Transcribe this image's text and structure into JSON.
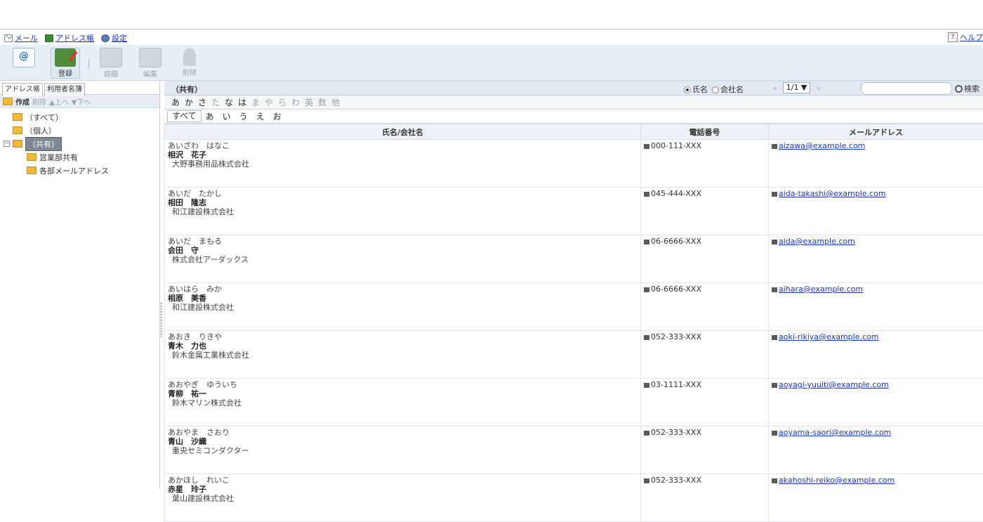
{
  "topbar": {
    "menu": [
      {
        "label": "メール",
        "icon": "mail-icon"
      },
      {
        "label": "アドレス帳",
        "icon": "address-book-icon"
      },
      {
        "label": "設定",
        "icon": "gear-icon"
      }
    ],
    "help_label": "ヘルプ"
  },
  "toolbar": {
    "mail": "",
    "register": "登録",
    "detail": "詳細",
    "edit": "編集",
    "delete": "削除"
  },
  "left": {
    "tabs": [
      "アドレス帳",
      "利用者名簿"
    ],
    "actions": {
      "create": "作成",
      "delete": "削除",
      "up": "▲上へ",
      "down": "▼下へ"
    },
    "tree": [
      {
        "label": "（すべて）"
      },
      {
        "label": "（個人）"
      },
      {
        "label": "（共有）"
      },
      {
        "label": "営業部共有"
      },
      {
        "label": "各部メールアドレス"
      }
    ]
  },
  "right": {
    "title": "（共有）",
    "radio_name": "氏名",
    "radio_company": "会社名",
    "page": "1/1 ▼",
    "search_label": "検索",
    "kana_index": [
      "あ",
      "か",
      "さ",
      "た",
      "な",
      "は",
      "ま",
      "や",
      "ら",
      "わ",
      "英",
      "数",
      "他"
    ],
    "sub_all": "すべて",
    "sub_kana": [
      "あ",
      "い",
      "う",
      "え",
      "お"
    ],
    "columns": [
      "氏名/会社名",
      "電話番号",
      "メールアドレス"
    ],
    "rows": [
      {
        "kana": "あいざわ　はなこ",
        "name": "相沢　花子",
        "company": "大野事務用品株式会社",
        "phone": "000-111-XXX",
        "email": "aizawa@example.com"
      },
      {
        "kana": "あいだ　たかし",
        "name": "相田　隆志",
        "company": "和江建設株式会社",
        "phone": "045-444-XXX",
        "email": "aida-takashi@example.com"
      },
      {
        "kana": "あいだ　まもる",
        "name": "会田　守",
        "company": "株式会社アーダックス",
        "phone": "06-6666-XXX",
        "email": "aida@example.com"
      },
      {
        "kana": "あいはら　みか",
        "name": "相原　美香",
        "company": "和江建設株式会社",
        "phone": "06-6666-XXX",
        "email": "aihara@example.com"
      },
      {
        "kana": "あおき　りきや",
        "name": "青木　力也",
        "company": "鈴木金属工業株式会社",
        "phone": "052-333-XXX",
        "email": "aoki-rikiya@example.com"
      },
      {
        "kana": "あおやぎ　ゆういち",
        "name": "青柳　祐一",
        "company": "鈴木マリン株式会社",
        "phone": "03-1111-XXX",
        "email": "aoyagi-yuuiti@example.com"
      },
      {
        "kana": "あおやま　さおり",
        "name": "青山　沙織",
        "company": "重央セミコンダクター",
        "phone": "052-333-XXX",
        "email": "aoyama-saori@example.com"
      },
      {
        "kana": "あかほし　れいこ",
        "name": "赤星　玲子",
        "company": "葉山建設株式会社",
        "phone": "052-333-XXX",
        "email": "akahoshi-reiko@example.com"
      }
    ]
  }
}
